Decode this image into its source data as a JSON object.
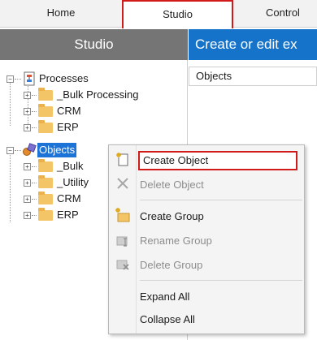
{
  "tabs": {
    "home": "Home",
    "studio": "Studio",
    "control": "Control"
  },
  "left_panel": {
    "title": "Studio"
  },
  "right_panel": {
    "title": "Create or edit ex",
    "column_header": "Objects"
  },
  "tree": {
    "processes": {
      "label": "Processes",
      "children": [
        "_Bulk Processing",
        "CRM",
        "ERP"
      ]
    },
    "objects": {
      "label": "Objects",
      "children": [
        "_Bulk",
        "_Utility",
        "CRM",
        "ERP"
      ]
    }
  },
  "context_menu": {
    "items": [
      {
        "label": "Create Object",
        "enabled": true,
        "icon": "new-object-icon"
      },
      {
        "label": "Delete Object",
        "enabled": false,
        "icon": "delete-x-icon"
      },
      {
        "label": "Create Group",
        "enabled": true,
        "icon": "new-folder-icon"
      },
      {
        "label": "Rename Group",
        "enabled": false,
        "icon": "rename-folder-icon"
      },
      {
        "label": "Delete Group",
        "enabled": false,
        "icon": "delete-folder-icon"
      },
      {
        "label": "Expand All",
        "enabled": true,
        "icon": ""
      },
      {
        "label": "Collapse All",
        "enabled": true,
        "icon": ""
      }
    ]
  },
  "colors": {
    "header_gray": "#757575",
    "header_blue": "#1573c9",
    "selection_blue": "#1e73d6",
    "highlight_red": "#d11a1a",
    "folder_yellow": "#f3c566"
  }
}
